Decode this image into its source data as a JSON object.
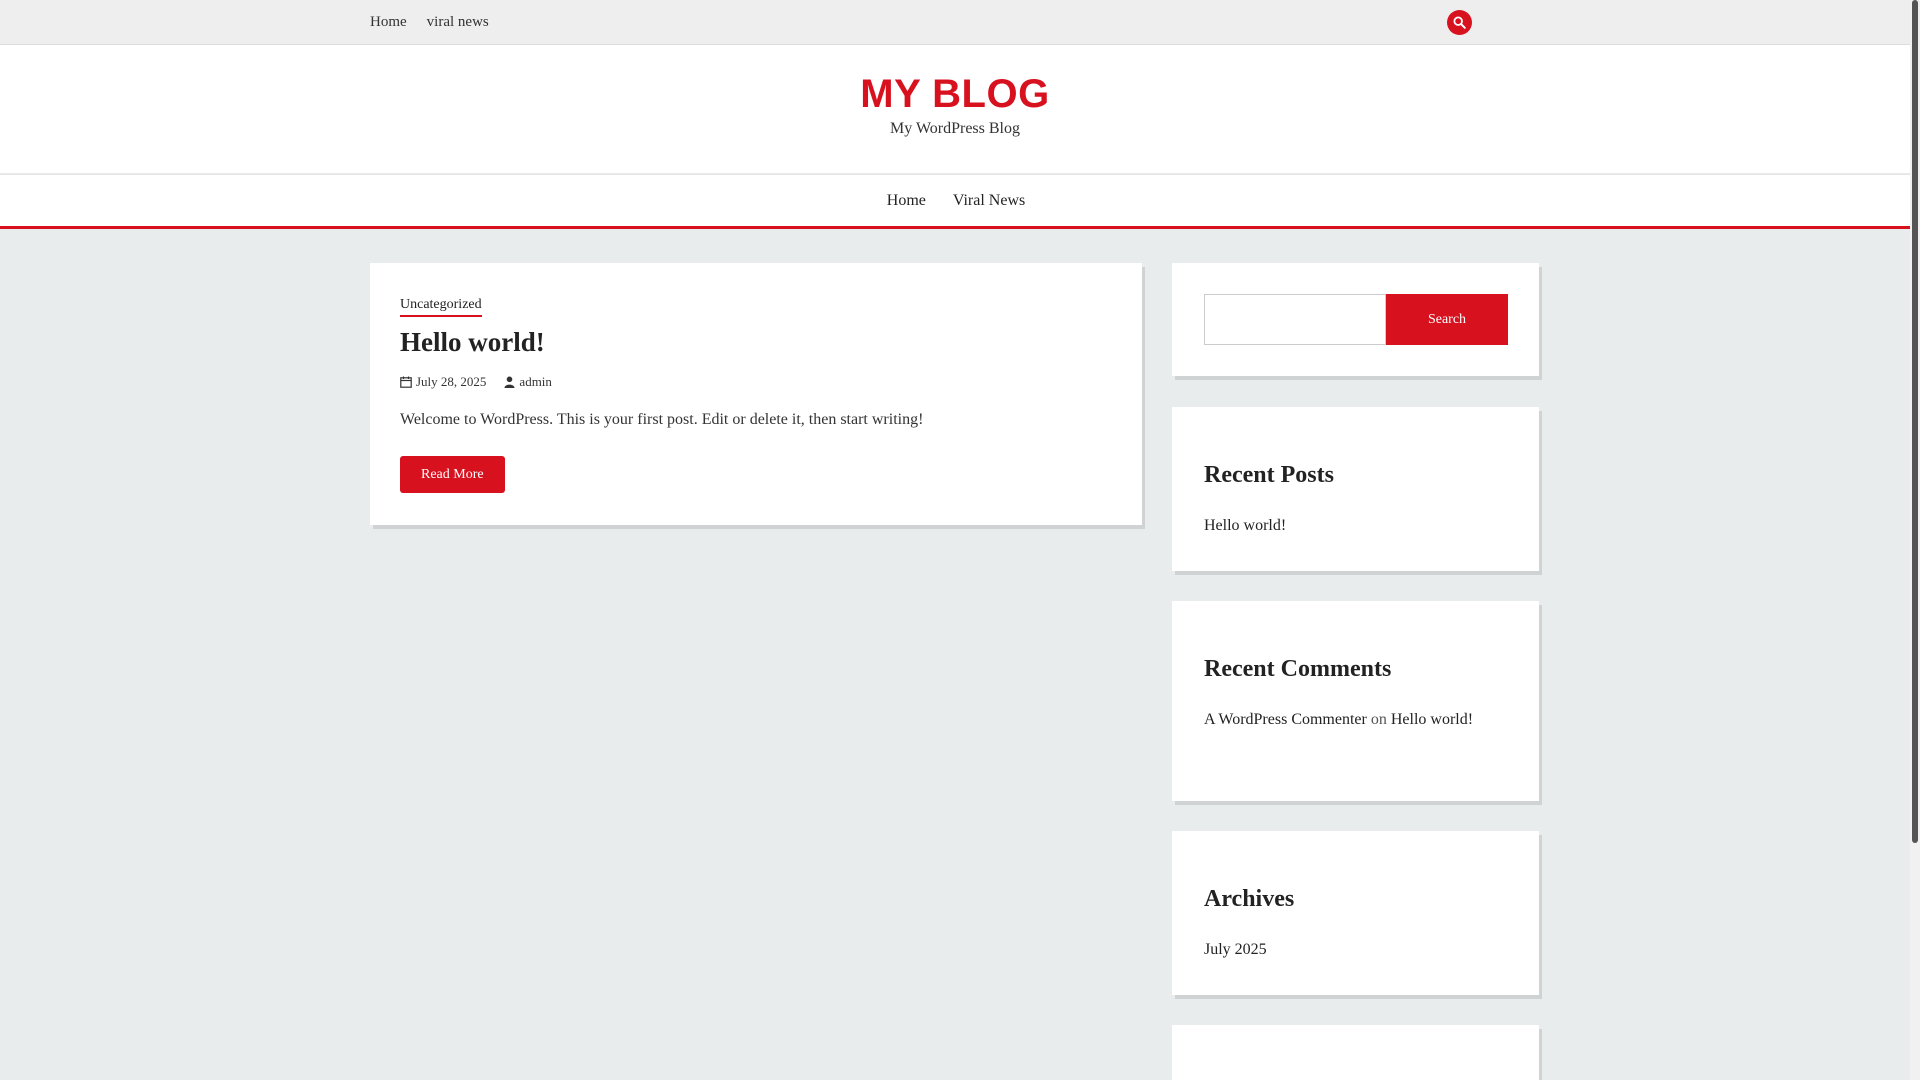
{
  "topbar": {
    "nav": [
      "Home",
      "viral news"
    ],
    "search_icon": "search-icon"
  },
  "header": {
    "site_title": "MY BLOG",
    "tagline": "My WordPress Blog"
  },
  "mainnav": {
    "items": [
      "Home",
      "Viral News"
    ]
  },
  "post": {
    "category": "Uncategorized",
    "title": "Hello world!",
    "date": "July 28, 2025",
    "author": "admin",
    "excerpt": "Welcome to WordPress. This is your first post. Edit or delete it, then start writing!",
    "read_more": "Read More"
  },
  "sidebar": {
    "search_button": "Search",
    "recent_posts": {
      "title": "Recent Posts",
      "items": [
        "Hello world!"
      ]
    },
    "recent_comments": {
      "title": "Recent Comments",
      "author": "A WordPress Commenter",
      "connector": "on",
      "post": "Hello world!"
    },
    "archives": {
      "title": "Archives",
      "items": [
        "July 2025"
      ]
    }
  },
  "colors": {
    "accent": "#d8111f",
    "background": "#e8ecec"
  }
}
